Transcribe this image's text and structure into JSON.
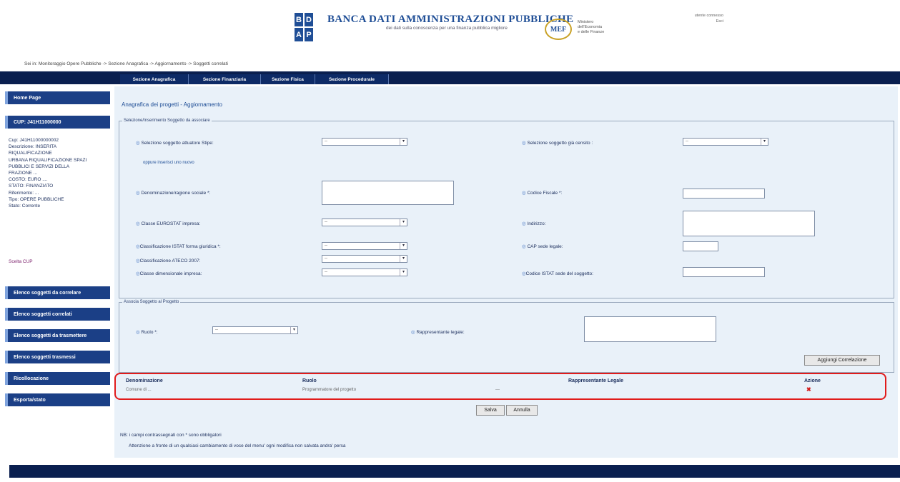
{
  "header": {
    "logo_letters": [
      "B",
      "D",
      "A",
      "P"
    ],
    "title": "BANCA DATI AMMINISTRAZIONI PUBBLICHE",
    "subtitle": "dei dati sulla conoscenza per una finanza pubblica migliore",
    "mef_logo": "MEF",
    "mef_text": "Ministero\ndell'Economia\ne delle Finanze",
    "user_info": [
      "utente connesso",
      "Esci"
    ]
  },
  "breadcrumb": "Sei in: Monitoraggio Opere Pubbliche -> Sezione Anagrafica -> Aggiornamento -> Soggetti correlati",
  "tabs": [
    "Sezione Anagrafica",
    "Sezione Finanziaria",
    "Sezione Fisica",
    "Sezione Procedurale"
  ],
  "sidebar": {
    "home": "Home Page",
    "cup_section": "CUP: J41H11000000",
    "info_lines": [
      "Cup: J41H11000000002",
      "Descrizione: INSERITA",
      "RIQUALIFICAZIONE",
      "URBANA RIQUALIFICAZIONE SPAZI",
      "PUBBLICI E SERVIZI DELLA",
      "FRAZIONE ...",
      "COSTO: EURO ....",
      "STATO: FINANZIATO",
      "Riferimento: ...",
      "Tipo: OPERE PUBBLICHE",
      "Stato: Corrente"
    ],
    "link": "Scelta CUP",
    "buttons": [
      "Elenco soggetti da correlare",
      "Elenco soggetti correlati",
      "Elenco soggetti da trasmettere",
      "Elenco soggetti trasmessi",
      "Ricollocazione",
      "Esporta/stato"
    ]
  },
  "main": {
    "title": "Anagrafica dei progetti - Aggiornamento",
    "section1_legend": "Selezione/Inserimento Soggetto da associare",
    "fields": {
      "attuatore_label": "Selezione soggetto attuatore Stipe:",
      "gia_censito_label": "Selezione soggetto già censito :",
      "or_insert": "oppure inserisci uno nuovo",
      "denominazione_label": "Denominazione/ragione sociale *:",
      "codice_fiscale_label": "Codice Fiscale *:",
      "classe_eurostat_label": "Classe EUROSTAT impresa:",
      "indirizzo_label": "Indirizzo:",
      "istat_giuridica_label": "Classificazione ISTAT forma giuridica *:",
      "cap_label": "CAP sede legale:",
      "ateco_label": "Classificazione ATECO 2007:",
      "dimensione_label": "Classe dimensionale impresa:",
      "codice_istat_label": "Codice ISTAT sede del soggetto:",
      "select_placeholder": "--"
    },
    "section2_legend": "Associa Soggetto al Progetto",
    "ruolo_label": "Ruolo *:",
    "rappresentante_label": "Rappresentante legale:",
    "add_button": "Aggiungi Correlazione",
    "table": {
      "headers": [
        "Denominazione",
        "Ruolo",
        "Rappresentante Legale",
        "Azione"
      ],
      "row": [
        "Comune di ...",
        "Programmatore del progetto",
        "---"
      ]
    },
    "save_button": "Salva",
    "cancel_button": "Annulla",
    "note1": "NB: i campi contrassegnati con * sono obbligatori",
    "note2": "Attenzione a fronte di un qualsiasi cambiamento di voce del menu' ogni modifica non salvata andra' persa"
  }
}
